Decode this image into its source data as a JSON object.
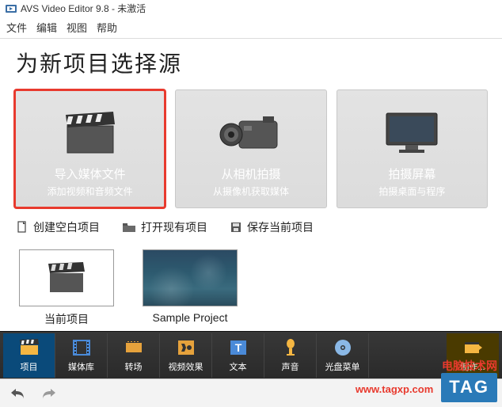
{
  "titlebar": {
    "text": "AVS Video Editor 9.8 - 未激活"
  },
  "menubar": {
    "items": [
      "文件",
      "编辑",
      "视图",
      "帮助"
    ]
  },
  "heading": "为新项目选择源",
  "sources": [
    {
      "title": "导入媒体文件",
      "subtitle": "添加视频和音频文件",
      "icon": "clapperboard-icon",
      "highlight": true
    },
    {
      "title": "从相机拍摄",
      "subtitle": "从摄像机获取媒体",
      "icon": "camera-icon",
      "highlight": false
    },
    {
      "title": "拍摄屏幕",
      "subtitle": "拍摄桌面与程序",
      "icon": "monitor-icon",
      "highlight": false
    }
  ],
  "actions": [
    {
      "label": "创建空白项目",
      "icon": "doc-new-icon"
    },
    {
      "label": "打开现有项目",
      "icon": "folder-icon"
    },
    {
      "label": "保存当前项目",
      "icon": "save-icon"
    }
  ],
  "projects": [
    {
      "label": "当前项目",
      "thumb": "clapper"
    },
    {
      "label": "Sample Project",
      "thumb": "image"
    }
  ],
  "bottombar": [
    {
      "label": "项目",
      "icon": "clapper-small-icon",
      "color": "#f5b642"
    },
    {
      "label": "媒体库",
      "icon": "filmstrip-icon",
      "color": "#4a8ad8"
    },
    {
      "label": "转场",
      "icon": "transition-icon",
      "color": "#e6a23c"
    },
    {
      "label": "视频效果",
      "icon": "fx-icon",
      "color": "#e6a23c"
    },
    {
      "label": "文本",
      "icon": "text-icon",
      "color": "#4a8ad8"
    },
    {
      "label": "声音",
      "icon": "mic-icon",
      "color": "#f5b642"
    },
    {
      "label": "光盘菜单",
      "icon": "disc-icon",
      "color": "#8ab8e6"
    },
    {
      "label": "制作...",
      "icon": "produce-icon",
      "color": "#f5b642"
    }
  ],
  "watermark": {
    "line1": "电脑技术网",
    "line2": "www.tagxp.com",
    "tag": "TAG"
  }
}
